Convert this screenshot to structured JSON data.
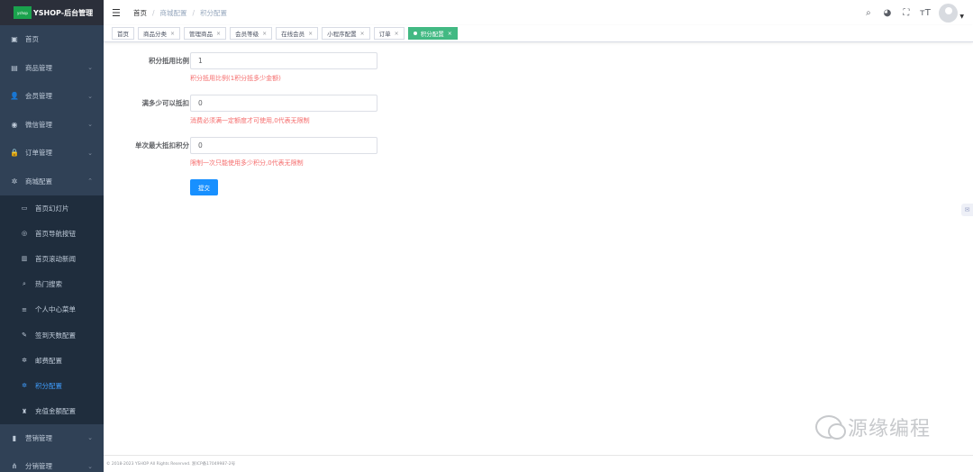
{
  "sidebar": {
    "logo_mark": "yshop",
    "logo_text": "YSHOP-后台管理",
    "menu_top": [
      {
        "label": "首页",
        "icon": "dashboard-icon"
      },
      {
        "label": "商品管理",
        "icon": "product-icon"
      },
      {
        "label": "会员管理",
        "icon": "user-icon"
      },
      {
        "label": "微信管理",
        "icon": "wechat-icon"
      },
      {
        "label": "订单管理",
        "icon": "lock-icon"
      },
      {
        "label": "商城配置",
        "icon": "gear-icon"
      }
    ],
    "submenu": [
      {
        "label": "首页幻灯片",
        "icon": "slide-icon"
      },
      {
        "label": "首页导航按钮",
        "icon": "nav-button-icon"
      },
      {
        "label": "首页滚动新闻",
        "icon": "news-icon"
      },
      {
        "label": "热门搜索",
        "icon": "search-icon"
      },
      {
        "label": "个人中心菜单",
        "icon": "menu-icon"
      },
      {
        "label": "签到天数配置",
        "icon": "edit-icon"
      },
      {
        "label": "邮费配置",
        "icon": "gear-icon"
      },
      {
        "label": "积分配置",
        "icon": "gear-icon",
        "active": true
      },
      {
        "label": "充值金额配置",
        "icon": "money-bag-icon"
      }
    ],
    "menu_bottom": [
      {
        "label": "营销管理",
        "icon": "chart-icon"
      },
      {
        "label": "分销管理",
        "icon": "share-icon"
      }
    ]
  },
  "navbar": {
    "breadcrumb": [
      "首页",
      "商城配置",
      "积分配置"
    ]
  },
  "tags": [
    {
      "label": "首页",
      "closable": false
    },
    {
      "label": "商品分类",
      "closable": true
    },
    {
      "label": "管理商品",
      "closable": true
    },
    {
      "label": "会员等级",
      "closable": true
    },
    {
      "label": "在线会员",
      "closable": true
    },
    {
      "label": "小程序配置",
      "closable": true
    },
    {
      "label": "订单",
      "closable": true
    },
    {
      "label": "积分配置",
      "closable": true,
      "active": true
    }
  ],
  "form": {
    "fields": [
      {
        "label": "积分抵用比例",
        "value": "1",
        "hint": "积分抵用比例(1积分抵多少金额)"
      },
      {
        "label": "满多少可以抵扣",
        "value": "0",
        "hint": "消费必须满一定额度才可使用,0代表无限制"
      },
      {
        "label": "单次最大抵扣积分",
        "value": "0",
        "hint": "限制一次只能使用多少积分,0代表无限制"
      }
    ],
    "submit_label": "提交"
  },
  "footer": {
    "text": "© 2018-2023 YSHOP All Rights Reserved.   浙ICP备17049987-2号"
  },
  "watermark": {
    "text": "源缘编程"
  },
  "colors": {
    "sidebar_bg": "#304156",
    "submenu_bg": "#1f2d3d",
    "active_tag": "#42b983",
    "primary": "#1890ff",
    "hint_red": "#f56c6c"
  }
}
